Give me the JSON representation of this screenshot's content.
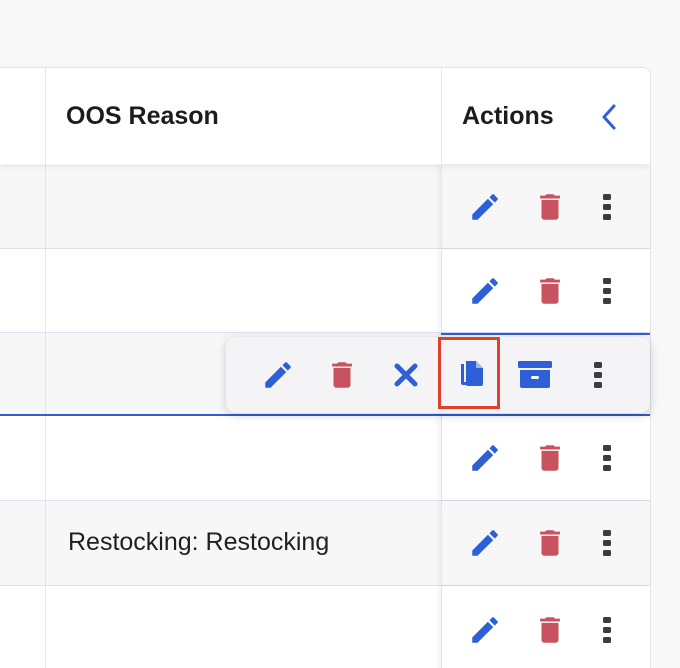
{
  "header": {
    "oos_reason": "OOS Reason",
    "actions": "Actions"
  },
  "rows": [
    {
      "oos_reason": ""
    },
    {
      "oos_reason": ""
    },
    {
      "oos_reason": ""
    },
    {
      "oos_reason": ""
    },
    {
      "oos_reason": "Restocking: Restocking"
    },
    {
      "oos_reason": ""
    }
  ],
  "colors": {
    "accent": "#2f5fd6",
    "delete": "#c8535f",
    "highlight": "#e0412b",
    "more": "#3c3c40"
  },
  "icons": {
    "edit": "pencil-icon",
    "delete": "trash-icon",
    "more": "vertical-dots-icon",
    "cancel": "close-icon",
    "copy": "copy-icon",
    "archive": "archive-icon",
    "collapse": "chevron-left-icon"
  }
}
